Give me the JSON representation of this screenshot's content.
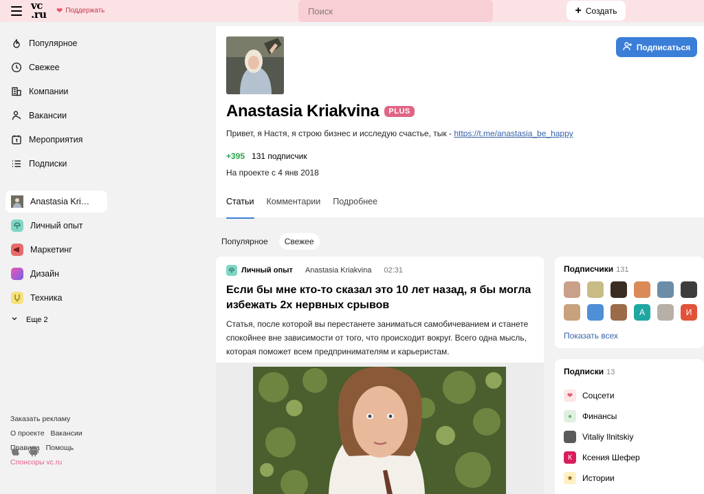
{
  "header": {
    "logo_top": "vc",
    "logo_bottom": ".ru",
    "support_label": "Поддержать",
    "search_placeholder": "Поиск",
    "create_label": "Создать"
  },
  "sidebar": {
    "items": [
      {
        "label": "Популярное",
        "icon": "fire-icon"
      },
      {
        "label": "Свежее",
        "icon": "clock-icon"
      },
      {
        "label": "Компании",
        "icon": "building-icon"
      },
      {
        "label": "Вакансии",
        "icon": "person-icon"
      },
      {
        "label": "Мероприятия",
        "icon": "calendar-icon"
      },
      {
        "label": "Подписки",
        "icon": "list-icon"
      }
    ],
    "subsites": [
      {
        "label": "Anastasia Kri…",
        "color": "#8a8a80"
      },
      {
        "label": "Личный опыт",
        "color": "#7fd6c4"
      },
      {
        "label": "Маркетинг",
        "color": "#e86b6b"
      },
      {
        "label": "Дизайн",
        "color": "#b15be8"
      },
      {
        "label": "Техника",
        "color": "#f5e27a"
      }
    ],
    "more_label": "Еще 2",
    "footer": {
      "ads": "Заказать рекламу",
      "about": "О проекте",
      "jobs": "Вакансии",
      "rules": "Правила",
      "help": "Помощь",
      "sponsors": "Спонсоры vc.ru"
    }
  },
  "profile": {
    "name": "Anastasia Kriakvina",
    "badge": "PLUS",
    "bio_text": "Привет, я Настя, я строю бизнес и исследую счастье, тык - ",
    "bio_link": "https://t.me/anastasia_be_happy",
    "karma": "+395",
    "subscribers": "131 подписчик",
    "since": "На проекте с 4 янв 2018",
    "subscribe_label": "Подписаться",
    "tabs": [
      "Статьи",
      "Комментарии",
      "Подробнее"
    ]
  },
  "feed": {
    "filters": [
      "Популярное",
      "Свежее"
    ]
  },
  "post": {
    "category": "Личный опыт",
    "author": "Anastasia Kriakvina",
    "time": "02:31",
    "title": "Если бы мне кто-то сказал это 10 лет назад, я бы могла избежать 2х нервных срывов",
    "text": "Статья, после которой вы перестанете заниматься самобичеванием и станете спокойнее вне зависимости от того, что происходит вокруг. Всего одна мысль, которая поможет всем предпринимателям и карьеристам."
  },
  "subscribers_widget": {
    "title": "Подписчики",
    "count": "131",
    "show_all": "Показать всех",
    "avatars": [
      {
        "letter": "",
        "color": "#c9a08a"
      },
      {
        "letter": "",
        "color": "#c9bb86"
      },
      {
        "letter": "",
        "color": "#3a2d22"
      },
      {
        "letter": "",
        "color": "#d98a55"
      },
      {
        "letter": "",
        "color": "#6b8da8"
      },
      {
        "letter": "",
        "color": "#3d3d3d"
      },
      {
        "letter": "",
        "color": "#c7a27c"
      },
      {
        "letter": "",
        "color": "#4f8fd6"
      },
      {
        "letter": "",
        "color": "#9b6b4a"
      },
      {
        "letter": "А",
        "color": "#1fa7a1"
      },
      {
        "letter": "",
        "color": "#b8b0a8"
      },
      {
        "letter": "И",
        "color": "#e0533a"
      }
    ]
  },
  "follows_widget": {
    "title": "Подписки",
    "count": "13",
    "items": [
      {
        "label": "Соцсети",
        "color": "#fde6e6",
        "glyph": "❤"
      },
      {
        "label": "Финансы",
        "color": "#dff0e0",
        "glyph": "●"
      },
      {
        "label": "Vitaliy Ilnitskiy",
        "color": "#5a5a5a",
        "glyph": ""
      },
      {
        "label": "Ксения Шефер",
        "color": "#d81e5b",
        "glyph": "К"
      },
      {
        "label": "Истории",
        "color": "#fff1c2",
        "glyph": "★"
      }
    ]
  }
}
